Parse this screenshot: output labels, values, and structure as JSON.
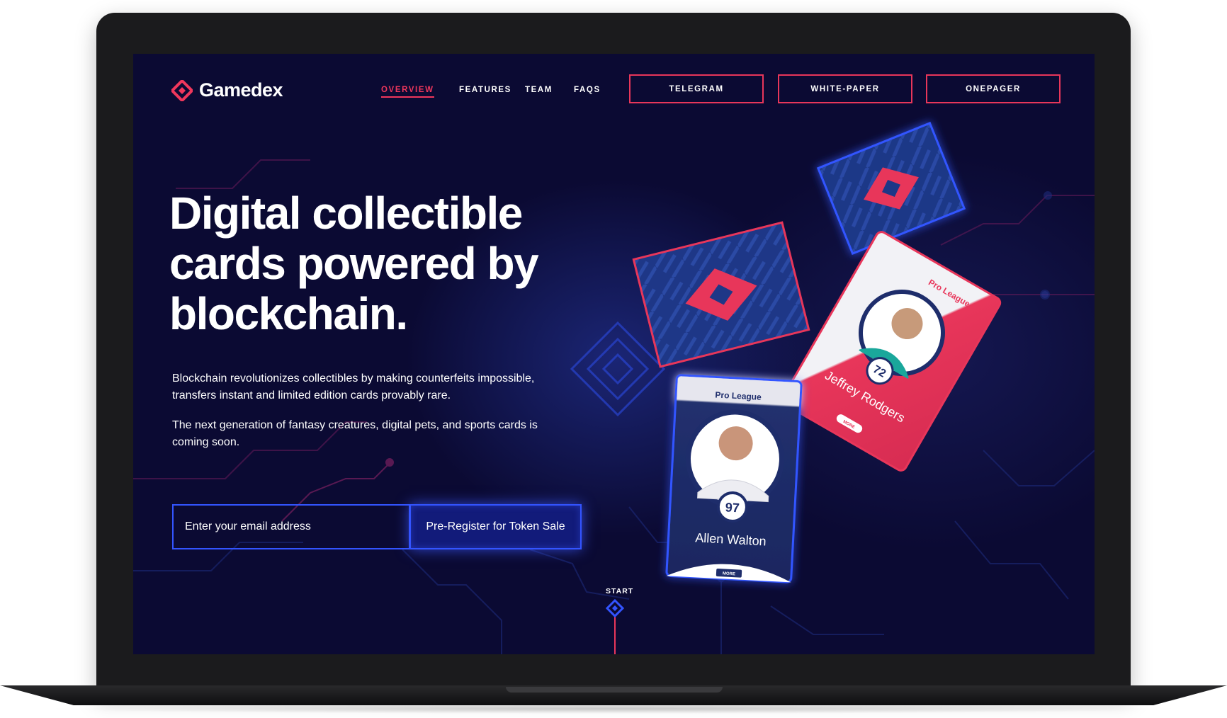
{
  "brand": {
    "name": "Gamedex",
    "logo_icon": "gamedex-diamond-logo-icon",
    "accent": "#f0375c"
  },
  "nav": {
    "links": [
      {
        "label": "OVERVIEW",
        "active": true
      },
      {
        "label": "FEATURES",
        "active": false
      },
      {
        "label": "TEAM",
        "active": false
      },
      {
        "label": "FAQS",
        "active": false
      }
    ],
    "buttons": [
      {
        "label": "TELEGRAM"
      },
      {
        "label": "WHITE-PAPER"
      },
      {
        "label": "ONEPAGER"
      }
    ]
  },
  "hero": {
    "headline": [
      "Digital collectible",
      "cards powered by",
      "blockchain."
    ],
    "paragraph1": "Blockchain revolutionizes collectibles by making counterfeits impossible, transfers instant and limited edition cards provably rare.",
    "paragraph2": "The next generation of fantasy creatures, digital pets, and sports cards is coming soon."
  },
  "signup": {
    "email_placeholder": "Enter your email address",
    "cta_label": "Pre-Register for Token Sale"
  },
  "start_marker": {
    "label": "START"
  },
  "cards": {
    "front_card": {
      "league": "Pro League",
      "rating": "97",
      "player": "Allen Walton",
      "more": "MORE"
    },
    "red_card": {
      "league": "Pro League",
      "rating": "72",
      "player": "Jeffrey Rodgers",
      "more": "MORE"
    }
  },
  "colors": {
    "background": "#0b0a33",
    "primary_blue": "#3354ff",
    "accent_red": "#e8365a"
  }
}
